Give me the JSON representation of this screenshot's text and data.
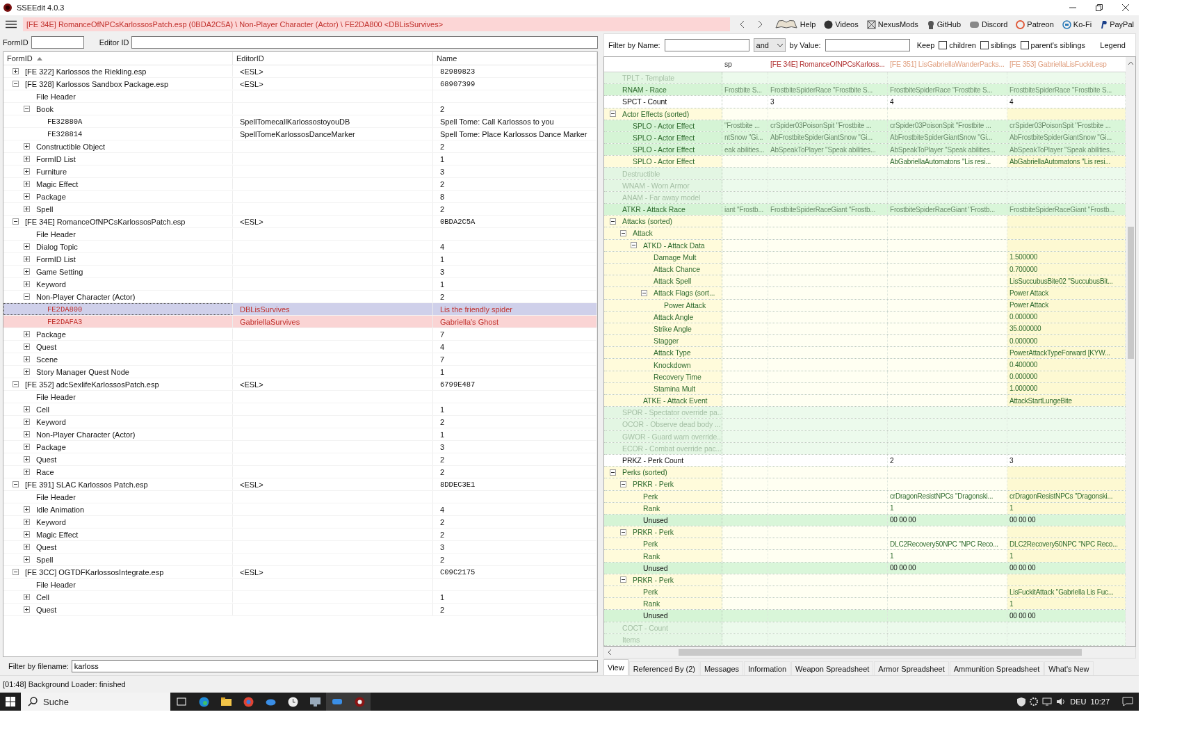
{
  "window": {
    "title": "SSEEdit 4.0.3"
  },
  "path_bar": {
    "text": "[FE 34E] RomanceOfNPCsKarlossosPatch.esp (0BDA2C5A) \\ Non-Player Character (Actor) \\ FE2DA800 <DBLisSurvives>"
  },
  "links": [
    {
      "label": "Help"
    },
    {
      "label": "Videos"
    },
    {
      "label": "NexusMods"
    },
    {
      "label": "GitHub"
    },
    {
      "label": "Discord"
    },
    {
      "label": "Patreon"
    },
    {
      "label": "Ko-Fi"
    },
    {
      "label": "PayPal"
    }
  ],
  "search": {
    "formid_label": "FormID",
    "editorid_label": "Editor ID"
  },
  "left_tree": {
    "columns": [
      "FormID",
      "EditorID",
      "Name"
    ],
    "nodes": [
      {
        "label": "[FE 322] Karlossos the Riekling.esp",
        "kind": "plugin",
        "editor_id": "<ESL>",
        "name": "82989823",
        "expanded": false
      },
      {
        "label": "[FE 328] Karlossos Sandbox Package.esp",
        "kind": "plugin",
        "editor_id": "<ESL>",
        "name": "68907399",
        "expanded": true,
        "children": [
          {
            "label": "File Header"
          },
          {
            "label": "Book",
            "name": "2",
            "expanded": true,
            "children": [
              {
                "label": "FE32880A",
                "kind": "record",
                "editor_id": "SpellTomecallKarlossostoyouDB",
                "name": "Spell Tome: Call Karlossos to you",
                "selected": false,
                "conflict": false
              },
              {
                "label": "FE328814",
                "kind": "record",
                "editor_id": "SpellTomeKarlossosDanceMarker",
                "name": "Spell Tome: Place Karlossos Dance Marker",
                "selected": false,
                "conflict": false
              }
            ]
          },
          {
            "label": "Constructible Object",
            "name": "2",
            "expanded": false
          },
          {
            "label": "FormID List",
            "name": "1",
            "expanded": false
          },
          {
            "label": "Furniture",
            "name": "3",
            "expanded": false
          },
          {
            "label": "Magic Effect",
            "name": "2",
            "expanded": false
          },
          {
            "label": "Package",
            "name": "8",
            "expanded": false
          },
          {
            "label": "Spell",
            "name": "2",
            "expanded": false
          }
        ]
      },
      {
        "label": "[FE 34E] RomanceOfNPCsKarlossosPatch.esp",
        "kind": "plugin",
        "editor_id": "<ESL>",
        "name": "0BDA2C5A",
        "expanded": true,
        "children": [
          {
            "label": "File Header"
          },
          {
            "label": "Dialog Topic",
            "name": "4",
            "expanded": false
          },
          {
            "label": "FormID List",
            "name": "1",
            "expanded": false
          },
          {
            "label": "Game Setting",
            "name": "3",
            "expanded": false
          },
          {
            "label": "Keyword",
            "name": "1",
            "expanded": false
          },
          {
            "label": "Non-Player Character (Actor)",
            "name": "2",
            "expanded": true,
            "children": [
              {
                "label": "FE2DA800",
                "kind": "record",
                "editor_id": "DBLisSurvives",
                "name": "Lis the friendly spider",
                "selected": true,
                "conflict": true
              },
              {
                "label": "FE2DAFA3",
                "kind": "record",
                "editor_id": "GabriellaSurvives",
                "name": "Gabriella's Ghost",
                "selected": false,
                "conflict": true
              }
            ]
          },
          {
            "label": "Package",
            "name": "7",
            "expanded": false
          },
          {
            "label": "Quest",
            "name": "4",
            "expanded": false
          },
          {
            "label": "Scene",
            "name": "7",
            "expanded": false
          },
          {
            "label": "Story Manager Quest Node",
            "name": "1",
            "expanded": false
          }
        ]
      },
      {
        "label": "[FE 352] adcSexlifeKarlossosPatch.esp",
        "kind": "plugin",
        "editor_id": "<ESL>",
        "name": "6799E487",
        "expanded": true,
        "children": [
          {
            "label": "File Header"
          },
          {
            "label": "Cell",
            "name": "1",
            "expanded": false
          },
          {
            "label": "Keyword",
            "name": "2",
            "expanded": false
          },
          {
            "label": "Non-Player Character (Actor)",
            "name": "1",
            "expanded": false
          },
          {
            "label": "Package",
            "name": "3",
            "expanded": false
          },
          {
            "label": "Quest",
            "name": "2",
            "expanded": false
          },
          {
            "label": "Race",
            "name": "2",
            "expanded": false
          }
        ]
      },
      {
        "label": "[FE 391] SLAC Karlossos Patch.esp",
        "kind": "plugin",
        "editor_id": "<ESL>",
        "name": "8DDEC3E1",
        "expanded": true,
        "children": [
          {
            "label": "File Header"
          },
          {
            "label": "Idle Animation",
            "name": "4",
            "expanded": false
          },
          {
            "label": "Keyword",
            "name": "2",
            "expanded": false
          },
          {
            "label": "Magic Effect",
            "name": "2",
            "expanded": false
          },
          {
            "label": "Quest",
            "name": "3",
            "expanded": false
          },
          {
            "label": "Spell",
            "name": "2",
            "expanded": false
          }
        ]
      },
      {
        "label": "[FE 3CC] OGTDFKarlossosIntegrate.esp",
        "kind": "plugin",
        "editor_id": "<ESL>",
        "name": "C09C2175",
        "expanded": true,
        "children": [
          {
            "label": "File Header"
          },
          {
            "label": "Cell",
            "name": "1",
            "expanded": false
          },
          {
            "label": "Quest",
            "name": "2",
            "expanded": false
          }
        ]
      }
    ]
  },
  "filename_filter": {
    "label": "Filter by filename:",
    "value": "karloss"
  },
  "record_view": {
    "filter": {
      "name_label": "Filter by Name:",
      "operator": "and",
      "value_label": "by Value:",
      "keep_label": "Keep",
      "options": [
        {
          "label": "children",
          "checked": false
        },
        {
          "label": "siblings",
          "checked": false
        },
        {
          "label": "parent's siblings",
          "checked": false
        }
      ],
      "legend": "Legend"
    },
    "columns": [
      {
        "label": "sp"
      },
      {
        "label": "[FE 34E] RomanceOfNPCsKarloss...",
        "color": "#b03030"
      },
      {
        "label": "[FE 351] LisGabriellaWanderPacks...",
        "color": "#e0a080"
      },
      {
        "label": "[FE 353] GabriellaLisFuckit.esp",
        "color": "#e0a080"
      }
    ],
    "rows": [
      {
        "label": "TPLT - Template",
        "kind": "absent"
      },
      {
        "label": "RNAM - Race",
        "kind": "match",
        "cells": {
          "col_1": "Frostbite S...",
          "col_2": "FrostbiteSpiderRace \"Frostbite S...",
          "col_3": "FrostbiteSpiderRace \"Frostbite S...",
          "col_4": "FrostbiteSpiderRace \"Frostbite S..."
        }
      },
      {
        "label": "SPCT - Count",
        "kind": "count",
        "cells": {
          "col_2": "3",
          "col_3": "4",
          "col_4": "4"
        }
      },
      {
        "label": "Actor Effects (sorted)",
        "kind": "override",
        "expanded": true,
        "children": [
          {
            "label": "SPLO - Actor Effect",
            "kind": "match",
            "cells": {
              "col_1": "\"Frostbite ...",
              "col_2": "crSpider03PoisonSpit \"Frostbite ...",
              "col_3": "crSpider03PoisonSpit \"Frostbite ...",
              "col_4": "crSpider03PoisonSpit \"Frostbite ..."
            }
          },
          {
            "label": "SPLO - Actor Effect",
            "kind": "match",
            "cells": {
              "col_1": "ntSnow \"Gi...",
              "col_2": "AbFrostbiteSpiderGiantSnow \"Gi...",
              "col_3": "AbFrostbiteSpiderGiantSnow \"Gi...",
              "col_4": "AbFrostbiteSpiderGiantSnow \"Gi..."
            }
          },
          {
            "label": "SPLO - Actor Effect",
            "kind": "match",
            "cells": {
              "col_1": "eak abilities...",
              "col_2": "AbSpeakToPlayer \"Speak abilities...",
              "col_3": "AbSpeakToPlayer \"Speak abilities...",
              "col_4": "AbSpeakToPlayer \"Speak abilities..."
            }
          },
          {
            "label": "SPLO - Actor Effect",
            "kind": "override",
            "cells": {
              "col_3": "AbGabriellaAutomatons \"Lis resi...",
              "col_4": "AbGabriellaAutomatons \"Lis resi..."
            }
          }
        ]
      },
      {
        "label": "Destructible",
        "kind": "absent"
      },
      {
        "label": "WNAM - Worn Armor",
        "kind": "absent"
      },
      {
        "label": "ANAM - Far away model",
        "kind": "absent"
      },
      {
        "label": "ATKR - Attack Race",
        "kind": "match",
        "cells": {
          "col_1": "iant \"Frostb...",
          "col_2": "FrostbiteSpiderRaceGiant \"Frostb...",
          "col_3": "FrostbiteSpiderRaceGiant \"Frostb...",
          "col_4": "FrostbiteSpiderRaceGiant \"Frostb..."
        }
      },
      {
        "label": "Attacks (sorted)",
        "kind": "override",
        "expanded": true,
        "children": [
          {
            "label": "Attack",
            "kind": "override",
            "expanded": true,
            "children": [
              {
                "label": "ATKD - Attack Data",
                "kind": "override",
                "expanded": true,
                "children": [
                  {
                    "label": "Damage Mult",
                    "kind": "override",
                    "cells": {
                      "col_4": "1.500000"
                    }
                  },
                  {
                    "label": "Attack Chance",
                    "kind": "override",
                    "cells": {
                      "col_4": "0.700000"
                    }
                  },
                  {
                    "label": "Attack Spell",
                    "kind": "override",
                    "cells": {
                      "col_4": "LisSuccubusBite02 \"SuccubusBit..."
                    }
                  },
                  {
                    "label": "Attack Flags (sort...",
                    "kind": "override",
                    "expanded": true,
                    "cells": {
                      "col_4": "Power Attack"
                    },
                    "children": [
                      {
                        "label": "Power Attack",
                        "kind": "override",
                        "cells": {
                          "col_4": "Power Attack"
                        }
                      }
                    ]
                  },
                  {
                    "label": "Attack Angle",
                    "kind": "override",
                    "cells": {
                      "col_4": "0.000000"
                    }
                  },
                  {
                    "label": "Strike Angle",
                    "kind": "override",
                    "cells": {
                      "col_4": "35.000000"
                    }
                  },
                  {
                    "label": "Stagger",
                    "kind": "override",
                    "cells": {
                      "col_4": "0.000000"
                    }
                  },
                  {
                    "label": "Attack Type",
                    "kind": "override",
                    "cells": {
                      "col_4": "PowerAttackTypeForward [KYW..."
                    }
                  },
                  {
                    "label": "Knockdown",
                    "kind": "override",
                    "cells": {
                      "col_4": "0.400000"
                    }
                  },
                  {
                    "label": "Recovery Time",
                    "kind": "override",
                    "cells": {
                      "col_4": "0.000000"
                    }
                  },
                  {
                    "label": "Stamina Mult",
                    "kind": "override",
                    "cells": {
                      "col_4": "1.000000"
                    }
                  }
                ]
              },
              {
                "label": "ATKE - Attack Event",
                "kind": "override",
                "cells": {
                  "col_4": "AttackStartLungeBite"
                }
              }
            ]
          }
        ]
      },
      {
        "label": "SPOR - Spectator override pa...",
        "kind": "absent"
      },
      {
        "label": "OCOR - Observe dead body ...",
        "kind": "absent"
      },
      {
        "label": "GWOR - Guard warn override...",
        "kind": "absent"
      },
      {
        "label": "ECOR - Combat override pac...",
        "kind": "absent"
      },
      {
        "label": "PRKZ - Perk Count",
        "kind": "count",
        "cells": {
          "col_3": "2",
          "col_4": "3"
        }
      },
      {
        "label": "Perks (sorted)",
        "kind": "override",
        "expanded": true,
        "children": [
          {
            "label": "PRKR - Perk",
            "kind": "override",
            "expanded": true,
            "children": [
              {
                "label": "Perk",
                "kind": "override",
                "cells": {
                  "col_3": "crDragonResistNPCs \"Dragonski...",
                  "col_4": "crDragonResistNPCs \"Dragonski..."
                }
              },
              {
                "label": "Rank",
                "kind": "override",
                "cells": {
                  "col_3": "1",
                  "col_4": "1"
                }
              },
              {
                "label": "Unused",
                "kind": "unused",
                "cells": {
                  "col_3": "00 00 00",
                  "col_4": "00 00 00"
                }
              }
            ]
          },
          {
            "label": "PRKR - Perk",
            "kind": "override",
            "expanded": true,
            "children": [
              {
                "label": "Perk",
                "kind": "override",
                "cells": {
                  "col_3": "DLC2Recovery50NPC \"NPC Reco...",
                  "col_4": "DLC2Recovery50NPC \"NPC Reco..."
                }
              },
              {
                "label": "Rank",
                "kind": "override",
                "cells": {
                  "col_3": "1",
                  "col_4": "1"
                }
              },
              {
                "label": "Unused",
                "kind": "unused",
                "cells": {
                  "col_3": "00 00 00",
                  "col_4": "00 00 00"
                }
              }
            ]
          },
          {
            "label": "PRKR - Perk",
            "kind": "override",
            "expanded": true,
            "children": [
              {
                "label": "Perk",
                "kind": "override",
                "cells": {
                  "col_4": "LisFuckitAttack \"Gabriella Lis Fuc..."
                }
              },
              {
                "label": "Rank",
                "kind": "override",
                "cells": {
                  "col_4": "1"
                }
              },
              {
                "label": "Unused",
                "kind": "unused",
                "cells": {
                  "col_4": "00 00 00"
                }
              }
            ]
          }
        ]
      },
      {
        "label": "COCT - Count",
        "kind": "absent"
      },
      {
        "label": "Items",
        "kind": "absent"
      }
    ]
  },
  "bottom_tabs": [
    {
      "label": "View",
      "selected": true
    },
    {
      "label": "Referenced By (2)",
      "selected": false
    },
    {
      "label": "Messages",
      "selected": false
    },
    {
      "label": "Information",
      "selected": false
    },
    {
      "label": "Weapon Spreadsheet",
      "selected": false
    },
    {
      "label": "Armor Spreadsheet",
      "selected": false
    },
    {
      "label": "Ammunition Spreadsheet",
      "selected": false
    },
    {
      "label": "What's New",
      "selected": false
    }
  ],
  "status_bar": {
    "text": "[01:48] Background Loader: finished"
  },
  "taskbar": {
    "search": "Suche",
    "language": "DEU",
    "time": "10:27"
  }
}
